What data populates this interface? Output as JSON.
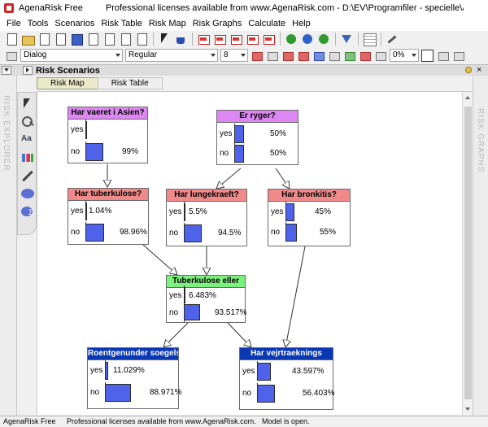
{
  "window": {
    "title_app": "AgenaRisk Free",
    "title_license": "Professional licenses available from www.AgenaRisk.com - D:\\EV\\Programfiler - specielle\\AgenaRisk\\A..."
  },
  "menu": [
    "File",
    "Tools",
    "Scenarios",
    "Risk Table",
    "Risk Map",
    "Risk Graphs",
    "Calculate",
    "Help"
  ],
  "format_bar": {
    "style": "Dialog",
    "weight": "Regular",
    "size": "8",
    "transparency": "0%"
  },
  "panel": {
    "title": "Risk Scenarios",
    "close": "×"
  },
  "sidebars": {
    "left": "RISK EXPLORER",
    "right": "RISK GRAPHS"
  },
  "tabs": [
    {
      "label": "Risk Map",
      "active": true
    },
    {
      "label": "Risk Table",
      "active": false
    }
  ],
  "nodes": [
    {
      "title": "Har vaeret i Asien?",
      "color": "#dd88f2",
      "states": [
        {
          "label": "yes",
          "value": 0.0,
          "text": ""
        },
        {
          "label": "no",
          "value": 99.0,
          "text": "99%"
        }
      ]
    },
    {
      "title": "Er ryger?",
      "color": "#dd88f2",
      "states": [
        {
          "label": "yes",
          "value": 50.0,
          "text": "50%"
        },
        {
          "label": "no",
          "value": 50.0,
          "text": "50%"
        }
      ]
    },
    {
      "title": "Har tuberkulose?",
      "color": "#f08a8a",
      "states": [
        {
          "label": "yes",
          "value": 1.04,
          "text": "1.04%"
        },
        {
          "label": "no",
          "value": 98.96,
          "text": "98.96%"
        }
      ]
    },
    {
      "title": "Har lungekraeft?",
      "color": "#f08a8a",
      "states": [
        {
          "label": "yes",
          "value": 5.5,
          "text": "5.5%"
        },
        {
          "label": "no",
          "value": 94.5,
          "text": "94.5%"
        }
      ]
    },
    {
      "title": "Har bronkitis?",
      "color": "#f08a8a",
      "states": [
        {
          "label": "yes",
          "value": 45.0,
          "text": "45%"
        },
        {
          "label": "no",
          "value": 55.0,
          "text": "55%"
        }
      ]
    },
    {
      "title": "Tuberkulose eller",
      "color": "#7ef07e",
      "states": [
        {
          "label": "yes",
          "value": 6.483,
          "text": "6.483%"
        },
        {
          "label": "no",
          "value": 93.517,
          "text": "93.517%"
        }
      ]
    },
    {
      "title": "Roentgenunder soegelsen",
      "color": "#0a38b4",
      "states": [
        {
          "label": "yes",
          "value": 11.029,
          "text": "11.029%"
        },
        {
          "label": "no",
          "value": 88.971,
          "text": "88.971%"
        }
      ]
    },
    {
      "title": "Har vejrtraeknings",
      "color": "#0a38b4",
      "states": [
        {
          "label": "yes",
          "value": 43.597,
          "text": "43.597%"
        },
        {
          "label": "no",
          "value": 56.403,
          "text": "56.403%"
        }
      ]
    }
  ],
  "status": {
    "app": "AgenaRisk Free",
    "license": "Professional licenses available from www.AgenaRisk.com.",
    "model": "Model is open."
  }
}
